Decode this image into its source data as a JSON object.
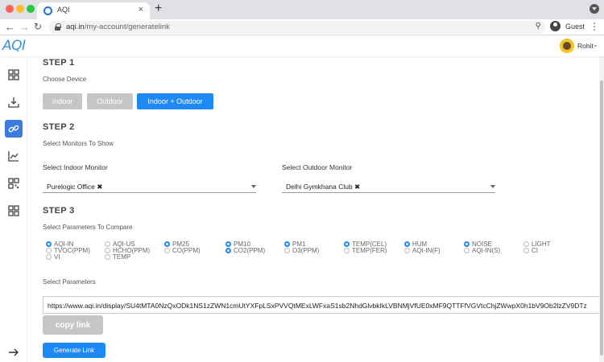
{
  "browser": {
    "tab_title": "AQI",
    "tab_close": "×",
    "new_tab": "+",
    "url_domain": "aqi.in",
    "url_path": "/my-account/generatelink",
    "profile_label": "Guest"
  },
  "header": {
    "logo": "AQI",
    "user_name": "Rohit"
  },
  "step1": {
    "title": "STEP 1",
    "subtitle": "Choose Device",
    "buttons": [
      {
        "label": "Indoor",
        "active": false
      },
      {
        "label": "Outdoor",
        "active": false
      },
      {
        "label": "Indoor + Outdoor",
        "active": true
      }
    ]
  },
  "step2": {
    "title": "STEP 2",
    "subtitle": "Select Monitors To Show",
    "indoor_label": "Select Indoor Monitor",
    "indoor_value": "Purelogic Office ✖",
    "outdoor_label": "Select Outdoor Monitor",
    "outdoor_value": "Delhi Gymkhana Club ✖"
  },
  "step3": {
    "title": "STEP 3",
    "subtitle": "Select Parameters To Compare",
    "params": [
      {
        "label": "AQI-IN",
        "selected": true
      },
      {
        "label": "AQI-US",
        "selected": false
      },
      {
        "label": "PM25",
        "selected": true
      },
      {
        "label": "PM10",
        "selected": true
      },
      {
        "label": "PM1",
        "selected": true
      },
      {
        "label": "TEMP(CEL)",
        "selected": true
      },
      {
        "label": "HUM",
        "selected": true
      },
      {
        "label": "NOISE",
        "selected": true
      },
      {
        "label": "LIGHT",
        "selected": false
      },
      {
        "label": "TVOC(PPM)",
        "selected": false
      },
      {
        "label": "HCHO(PPM)",
        "selected": false
      },
      {
        "label": "CO(PPM)",
        "selected": false
      },
      {
        "label": "CO2(PPM)",
        "selected": true
      },
      {
        "label": "O3(PPM)",
        "selected": false
      },
      {
        "label": "TEMP(FER)",
        "selected": false
      },
      {
        "label": "AQI-IN(F)",
        "selected": false
      },
      {
        "label": "AQI-IN(S)",
        "selected": false
      },
      {
        "label": "CI",
        "selected": false
      },
      {
        "label": "VI",
        "selected": false
      },
      {
        "label": "TEMP",
        "selected": false
      }
    ],
    "select_params_label": "Select Parameters",
    "link": "https://www.aqi.in/display/SU4tMTA0NzQxODk1NS1zZWN1cmUtYXFpLSxPVVQtMExLWFxaS1sb2NhdGlvbkIkLVBNMjVfUE0xMF9QTTFfVGVtcChjZWwpX0h1bV9Ob2lzZV9DTz",
    "copy_label": "copy link",
    "generate_label": "Generate Link"
  },
  "colors": {
    "accent": "#1e88f5",
    "disabled": "#c6c6c6",
    "sidebar_active": "#3a7be0"
  }
}
